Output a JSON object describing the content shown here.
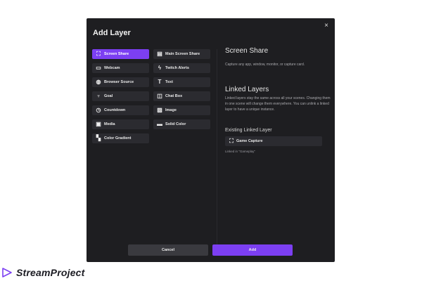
{
  "dialog": {
    "title": "Add Layer",
    "close_icon": "×",
    "layer_types_col1": [
      {
        "label": "Screen Share",
        "icon": "⛶",
        "selected": true
      },
      {
        "label": "Webcam",
        "icon": "▭"
      },
      {
        "label": "Browser Source",
        "icon": "◍"
      },
      {
        "label": "Goal",
        "icon": "♆"
      },
      {
        "label": "Countdown",
        "icon": "◷"
      },
      {
        "label": "Media",
        "icon": "▣"
      },
      {
        "label": "Color Gradient",
        "icon": "▚"
      }
    ],
    "layer_types_col2": [
      {
        "label": "Main Screen Share",
        "icon": "▤"
      },
      {
        "label": "Twitch Alerts",
        "icon": "ϟ"
      },
      {
        "label": "Text",
        "icon": "T"
      },
      {
        "label": "Chat Box",
        "icon": "◫"
      },
      {
        "label": "Image",
        "icon": "▨"
      },
      {
        "label": "Solid Color",
        "icon": "▬"
      }
    ],
    "detail": {
      "heading": "Screen Share",
      "description": "Capture any app, window, monitor, or capture card.",
      "linked_heading": "Linked Layers",
      "linked_description": "Linked layers stay the same across all your scenes. Changing them in one scene will change them everywhere. You can unlink a linked layer to have a unique instance.",
      "existing_heading": "Existing Linked Layer",
      "existing_item": {
        "label": "Game Capture",
        "icon": "⛶"
      },
      "linked_in": "Linked in \"Gameplay\""
    },
    "footer": {
      "cancel_label": "Cancel",
      "add_label": "Add"
    }
  },
  "brand": {
    "name": "StreamProject",
    "accent": "#7c3ff2"
  }
}
